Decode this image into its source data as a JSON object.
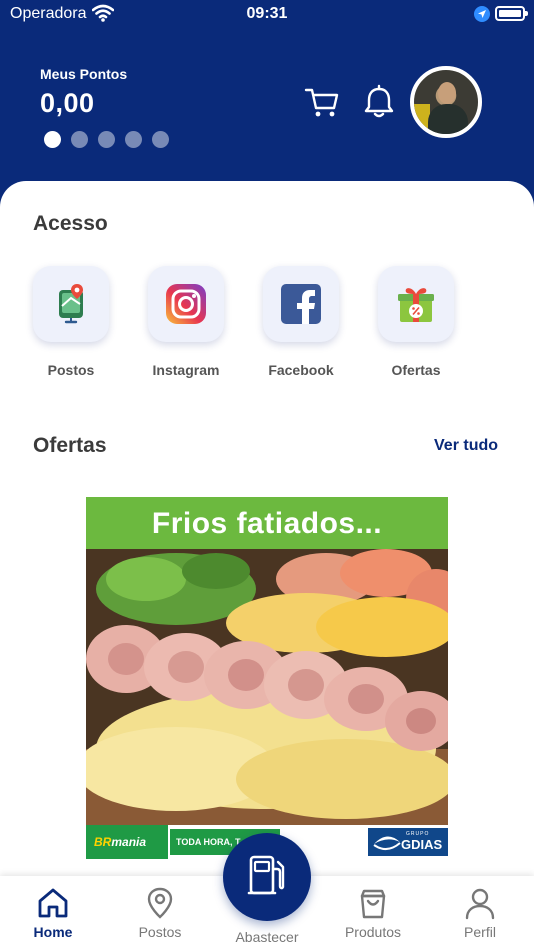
{
  "status_bar": {
    "carrier": "Operadora",
    "time": "09:31"
  },
  "header": {
    "points_label": "Meus Pontos",
    "points_value": "0,00",
    "carousel": {
      "count": 5,
      "active_index": 0
    },
    "background_color": "#0a2a7a"
  },
  "acesso": {
    "title": "Acesso",
    "items": [
      {
        "label": "Postos",
        "icon": "map-pin-icon"
      },
      {
        "label": "Instagram",
        "icon": "instagram-icon"
      },
      {
        "label": "Facebook",
        "icon": "facebook-icon"
      },
      {
        "label": "Ofertas",
        "icon": "gift-icon"
      }
    ]
  },
  "ofertas": {
    "title": "Ofertas",
    "see_all": "Ver tudo",
    "banner": {
      "title": "Frios fatiados...",
      "brand_logo": "BRmania",
      "tagline": "TODA HORA, T",
      "group_logo_small": "GRUPO",
      "group_logo": "GDIAS"
    }
  },
  "tab_bar": {
    "tabs": [
      {
        "label": "Home",
        "icon": "home-icon",
        "active": true
      },
      {
        "label": "Postos",
        "icon": "location-pin-icon",
        "active": false
      },
      {
        "label": "Abastecer",
        "icon": "fuel-pump-icon",
        "active": false
      },
      {
        "label": "Produtos",
        "icon": "shopping-bag-icon",
        "active": false
      },
      {
        "label": "Perfil",
        "icon": "user-icon",
        "active": false
      }
    ],
    "accent_color": "#0a2a7a"
  }
}
